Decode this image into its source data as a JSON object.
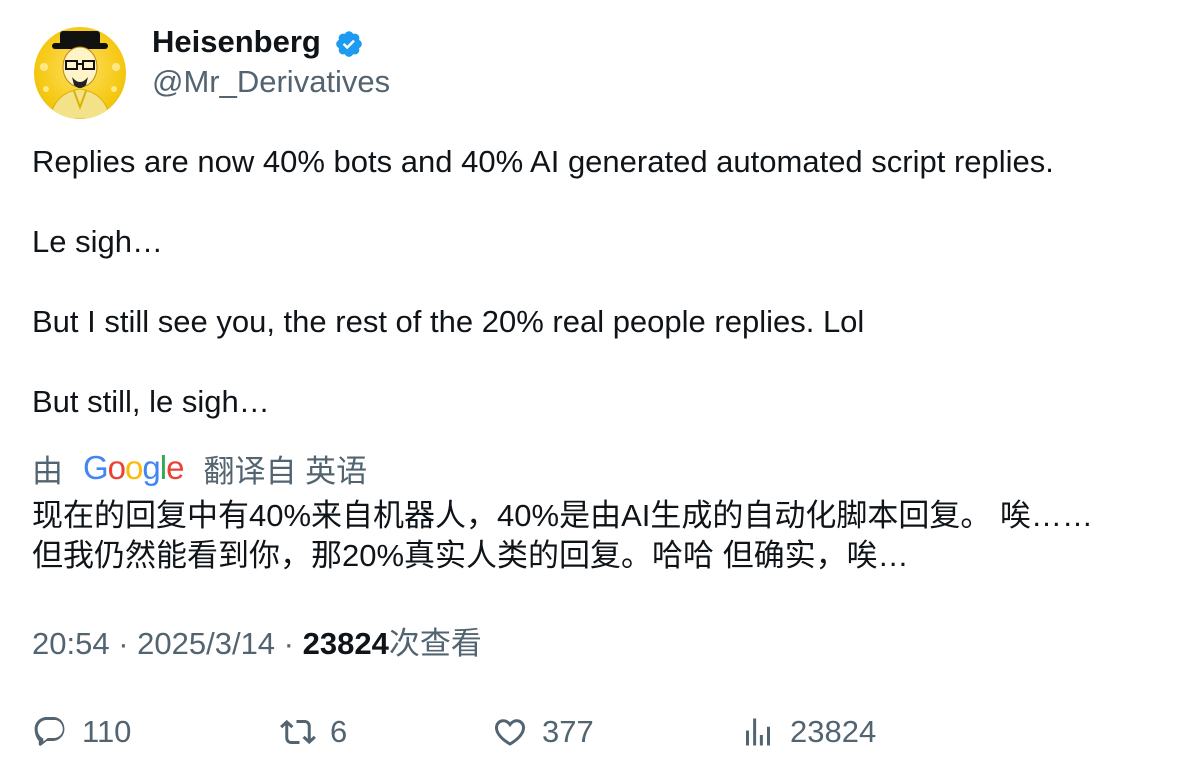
{
  "author": {
    "display_name": "Heisenberg",
    "handle": "@Mr_Derivatives",
    "verified": true
  },
  "tweet": {
    "paragraphs": [
      "Replies are now 40% bots and 40% AI generated automated script replies.",
      "Le sigh…",
      "But I still see you, the rest of the 20% real people replies. Lol",
      "But still, le sigh…"
    ]
  },
  "translation": {
    "prefix": "由",
    "provider_logo_text": [
      "G",
      "o",
      "o",
      "g",
      "l",
      "e"
    ],
    "provider_logo_colors": [
      "#4285F4",
      "#EA4335",
      "#FBBC05",
      "#4285F4",
      "#34A853",
      "#EA4335"
    ],
    "suffix": "翻译自 英语",
    "lines": [
      "现在的回复中有40%来自机器人，40%是由AI生成的自动化脚本回复。 唉……",
      "但我仍然能看到你，那20%真实人类的回复。哈哈 但确实，唉…"
    ]
  },
  "meta": {
    "time": "20:54",
    "separator": " · ",
    "date": "2025/3/14",
    "views_count": "23824",
    "views_label": "次查看"
  },
  "actions": {
    "replies": "110",
    "retweets": "6",
    "likes": "377",
    "views": "23824"
  },
  "colors": {
    "text": "#0f1419",
    "secondary": "#536471",
    "verified": "#1d9bf0",
    "avatar_bg": "#f6c915"
  }
}
